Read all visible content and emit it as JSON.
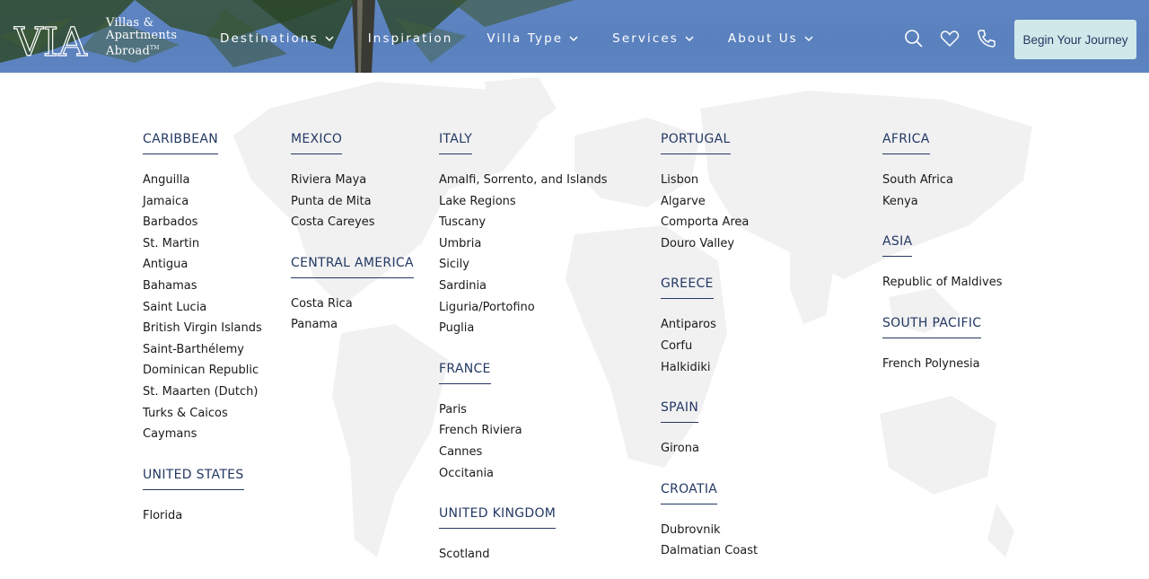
{
  "brand": {
    "logo_letters": "VIA",
    "name_line1": "Villas &",
    "name_line2": "Apartments",
    "name_line3": "Abroad",
    "trademark": "TM"
  },
  "nav": {
    "items": [
      {
        "label": "Destinations",
        "has_dropdown": true
      },
      {
        "label": "Inspiration",
        "has_dropdown": false
      },
      {
        "label": "Villa Type",
        "has_dropdown": true
      },
      {
        "label": "Services",
        "has_dropdown": true
      },
      {
        "label": "About Us",
        "has_dropdown": true
      }
    ]
  },
  "tools": {
    "icons": [
      "search-icon",
      "heart-icon",
      "phone-icon"
    ],
    "cta_label": "Begin Your Journey"
  },
  "colors": {
    "header_blue": "#5f86c2",
    "navy": "#233863",
    "cta_bg": "#d1e8ea",
    "text": "#1a1a1a"
  },
  "menu": {
    "columns": [
      {
        "regions": [
          {
            "title": "CARIBBEAN",
            "items": [
              "Anguilla",
              "Jamaica",
              "Barbados",
              "St. Martin",
              "Antigua",
              "Bahamas",
              "Saint Lucia",
              "British Virgin Islands",
              "Saint-Barthélemy",
              "Dominican Republic",
              "St. Maarten (Dutch)",
              "Turks & Caicos",
              "Caymans"
            ]
          },
          {
            "title": "UNITED STATES",
            "items": [
              "Florida"
            ]
          }
        ]
      },
      {
        "regions": [
          {
            "title": "MEXICO",
            "items": [
              "Riviera Maya",
              "Punta de Mita",
              "Costa Careyes"
            ]
          },
          {
            "title": "CENTRAL AMERICA",
            "items": [
              "Costa Rica",
              "Panama"
            ]
          }
        ]
      },
      {
        "regions": [
          {
            "title": "ITALY",
            "items": [
              "Amalfi, Sorrento, and Islands",
              "Lake Regions",
              "Tuscany",
              "Umbria",
              "Sicily",
              "Sardinia",
              "Liguria/Portofino",
              "Puglia"
            ]
          },
          {
            "title": "FRANCE",
            "items": [
              "Paris",
              "French Riviera",
              "Cannes",
              "Occitania"
            ]
          },
          {
            "title": "UNITED KINGDOM",
            "items": [
              "Scotland"
            ]
          }
        ]
      },
      {
        "regions": [
          {
            "title": "PORTUGAL",
            "items": [
              "Lisbon",
              "Algarve",
              "Comporta Area",
              "Douro Valley"
            ]
          },
          {
            "title": "GREECE",
            "items": [
              "Antiparos",
              "Corfu",
              "Halkidiki"
            ]
          },
          {
            "title": "SPAIN",
            "items": [
              "Girona"
            ]
          },
          {
            "title": "CROATIA",
            "items": [
              "Dubrovnik",
              "Dalmatian Coast"
            ]
          }
        ]
      },
      {
        "regions": [
          {
            "title": "AFRICA",
            "items": [
              "South Africa",
              "Kenya"
            ]
          },
          {
            "title": "ASIA",
            "items": [
              "Republic of Maldives"
            ]
          },
          {
            "title": "SOUTH PACIFIC",
            "items": [
              "French Polynesia"
            ]
          }
        ]
      }
    ]
  }
}
